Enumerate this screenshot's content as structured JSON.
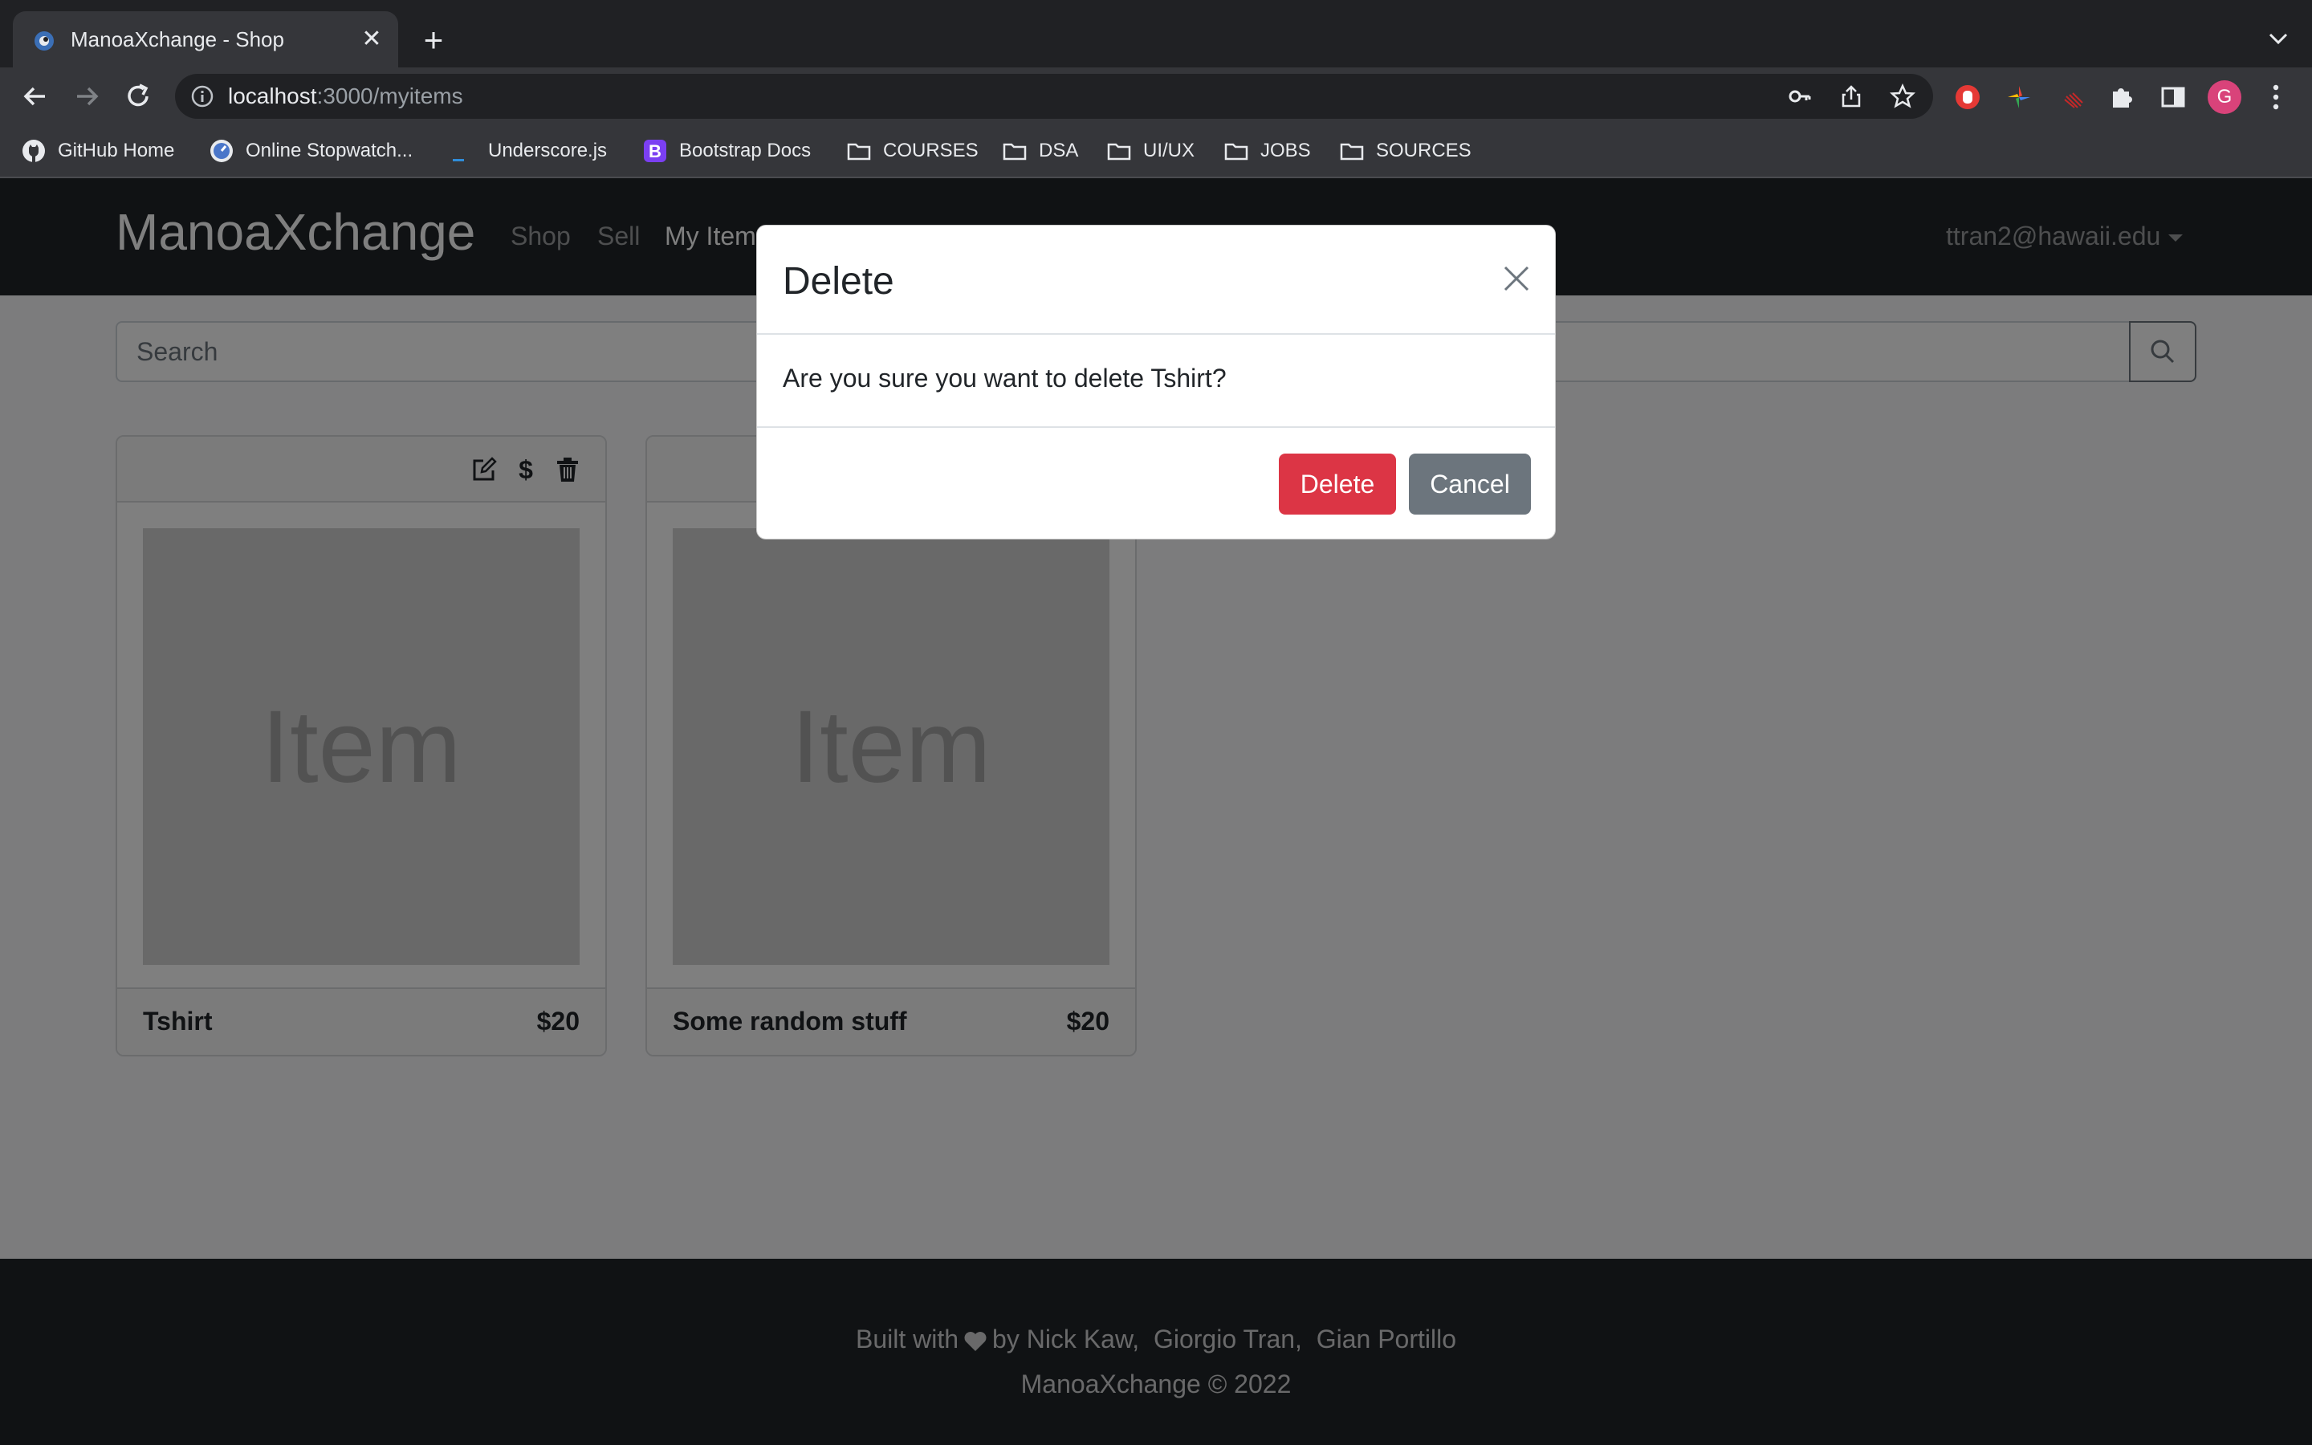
{
  "browser": {
    "tab_title": "ManoaXchange - Shop",
    "url_host": "localhost",
    "url_path": ":3000/myitems",
    "avatar_letter": "G",
    "bookmarks": [
      {
        "label": "GitHub Home",
        "icon": "github-icon"
      },
      {
        "label": "Online Stopwatch...",
        "icon": "stopwatch-icon"
      },
      {
        "label": "Underscore.js",
        "icon": "underscore-icon"
      },
      {
        "label": "Bootstrap Docs",
        "icon": "bootstrap-icon"
      },
      {
        "label": "COURSES",
        "icon": "folder-icon"
      },
      {
        "label": "DSA",
        "icon": "folder-icon"
      },
      {
        "label": "UI/UX",
        "icon": "folder-icon"
      },
      {
        "label": "JOBS",
        "icon": "folder-icon"
      },
      {
        "label": "SOURCES",
        "icon": "folder-icon"
      }
    ]
  },
  "navbar": {
    "brand": "ManoaXchange",
    "links": [
      "Shop",
      "Sell",
      "My Items"
    ],
    "user": "ttran2@hawaii.edu"
  },
  "search": {
    "placeholder": "Search"
  },
  "items": [
    {
      "image_text": "Item",
      "name": "Tshirt",
      "price": "$20"
    },
    {
      "image_text": "Item",
      "name": "Some random stuff",
      "price": "$20"
    }
  ],
  "card_actions": {
    "price_symbol": "$"
  },
  "footer": {
    "built_with": "Built with",
    "by": "by Nick Kaw,  Giorgio Tran,  Gian Portillo",
    "copyright": "ManoaXchange © 2022"
  },
  "modal": {
    "title": "Delete",
    "message": "Are you sure you want to delete Tshirt?",
    "delete_label": "Delete",
    "cancel_label": "Cancel"
  },
  "colors": {
    "danger": "#dc3545",
    "secondary": "#6c757d",
    "navbar": "#212529"
  }
}
